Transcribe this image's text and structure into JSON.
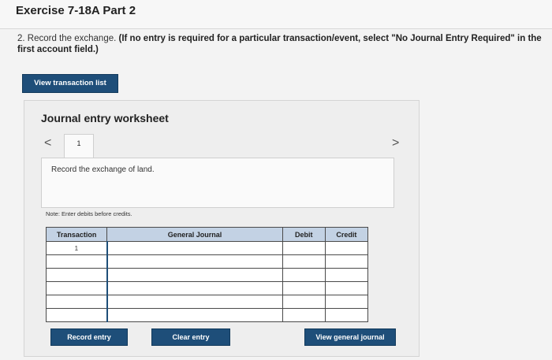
{
  "header": {
    "title": "Exercise 7-18A Part 2"
  },
  "instruction": {
    "text": "2. Record the exchange. ",
    "bold": "(If no entry is required for a particular transaction/event, select \"No Journal Entry Required\" in the first account field.)"
  },
  "buttons": {
    "view_transactions": "View transaction list",
    "record_entry": "Record entry",
    "clear_entry": "Clear entry",
    "view_general_journal": "View general journal"
  },
  "worksheet": {
    "title": "Journal entry worksheet",
    "nav_prev": "<",
    "nav_next": ">",
    "tab_label": "1",
    "description": "Record the exchange of land.",
    "note": "Note: Enter debits before credits."
  },
  "table": {
    "headers": [
      "Transaction",
      "General Journal",
      "Debit",
      "Credit"
    ],
    "rows": [
      [
        "1",
        "",
        "",
        ""
      ],
      [
        "",
        "",
        "",
        ""
      ],
      [
        "",
        "",
        "",
        ""
      ],
      [
        "",
        "",
        "",
        ""
      ],
      [
        "",
        "",
        "",
        ""
      ],
      [
        "",
        "",
        "",
        ""
      ]
    ]
  }
}
